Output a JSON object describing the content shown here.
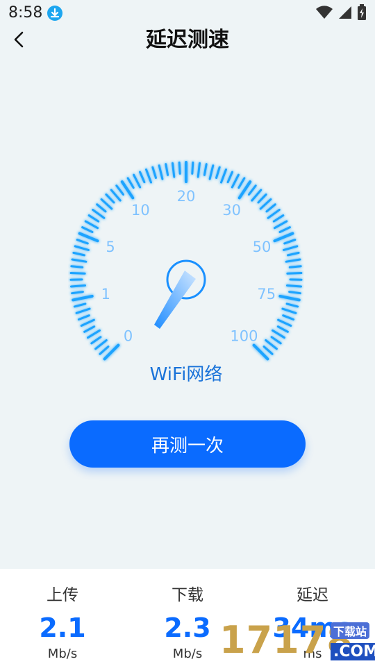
{
  "status_bar": {
    "time": "8:58"
  },
  "header": {
    "title": "延迟测速"
  },
  "gauge": {
    "ticks": [
      "0",
      "1",
      "5",
      "10",
      "20",
      "30",
      "50",
      "75",
      "100"
    ],
    "network_label": "WiFi网络",
    "needle_value": "1"
  },
  "retest_button": {
    "label": "再测一次"
  },
  "stats": [
    {
      "label": "上传",
      "value": "2.1",
      "unit": "Mb/s"
    },
    {
      "label": "下载",
      "value": "2.3",
      "unit": "Mb/s"
    },
    {
      "label": "延迟",
      "value": "34ms",
      "unit": "ms"
    }
  ],
  "watermark": {
    "main": "17178",
    "top": "下载站",
    "bottom": ".COM"
  },
  "colors": {
    "accent": "#0a6bff",
    "gauge_ticks": "#1aa3ff",
    "background": "#eef4f6"
  }
}
